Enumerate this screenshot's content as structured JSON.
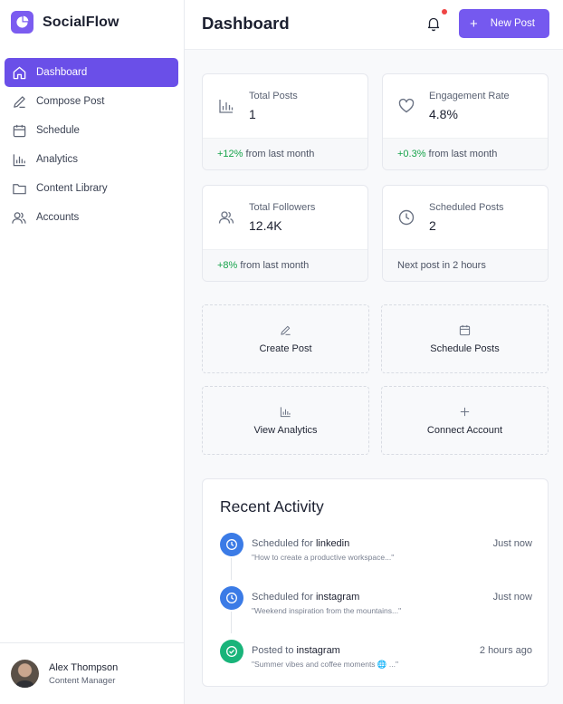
{
  "brand": {
    "name": "SocialFlow",
    "accent": "#7559ef"
  },
  "sidebar": {
    "items": [
      {
        "label": "Dashboard",
        "icon": "home-icon",
        "active": true
      },
      {
        "label": "Compose Post",
        "icon": "pencil-icon"
      },
      {
        "label": "Schedule",
        "icon": "calendar-icon"
      },
      {
        "label": "Analytics",
        "icon": "bar-chart-icon"
      },
      {
        "label": "Content Library",
        "icon": "folder-icon"
      },
      {
        "label": "Accounts",
        "icon": "users-icon"
      }
    ],
    "user": {
      "name": "Alex Thompson",
      "role": "Content Manager"
    }
  },
  "header": {
    "title": "Dashboard",
    "new_post_label": "New Post",
    "notification_badge": true
  },
  "stats": [
    {
      "label": "Total Posts",
      "value": "1",
      "change": "+12%",
      "change_suffix": " from last month",
      "icon": "bar-chart-icon"
    },
    {
      "label": "Engagement Rate",
      "value": "4.8%",
      "change": "+0.3%",
      "change_suffix": " from last month",
      "icon": "heart-icon"
    },
    {
      "label": "Total Followers",
      "value": "12.4K",
      "change": "+8%",
      "change_suffix": " from last month",
      "icon": "users-icon"
    },
    {
      "label": "Scheduled Posts",
      "value": "2",
      "change": "",
      "change_suffix": "Next post in 2 hours",
      "icon": "clock-icon"
    }
  ],
  "actions": [
    {
      "label": "Create Post",
      "icon": "pencil-icon"
    },
    {
      "label": "Schedule Posts",
      "icon": "calendar-icon"
    },
    {
      "label": "View Analytics",
      "icon": "bar-chart-icon"
    },
    {
      "label": "Connect Account",
      "icon": "plus-icon"
    }
  ],
  "activity": {
    "title": "Recent Activity",
    "items": [
      {
        "prefix": "Scheduled for ",
        "platform": "linkedin",
        "excerpt": "\"How to create a productive workspace...\"",
        "time": "Just now",
        "status": "scheduled",
        "icon": "clock-icon"
      },
      {
        "prefix": "Scheduled for ",
        "platform": "instagram",
        "excerpt": "\"Weekend inspiration from the mountains...\"",
        "time": "Just now",
        "status": "scheduled",
        "icon": "clock-icon"
      },
      {
        "prefix": "Posted to ",
        "platform": "instagram",
        "excerpt": "\"Summer vibes and coffee moments 🌐 ...\"",
        "time": "2 hours ago",
        "status": "posted",
        "icon": "check-icon"
      }
    ]
  }
}
